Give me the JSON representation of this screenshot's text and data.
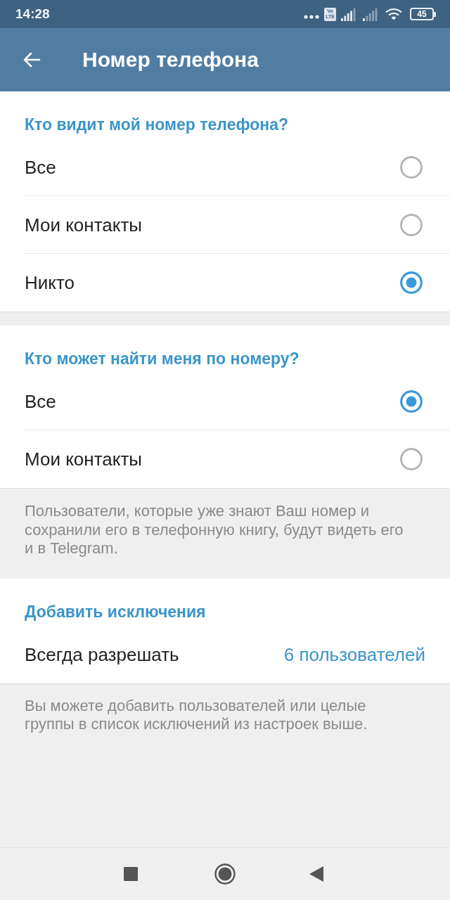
{
  "status_bar": {
    "time": "14:28",
    "network_badge": [
      "Vo",
      "LTE"
    ],
    "battery": "45"
  },
  "app_bar": {
    "title": "Номер телефона"
  },
  "sections": [
    {
      "header": "Кто видит мой номер телефона?",
      "items": [
        {
          "kind": "radio",
          "label": "Все",
          "selected": false
        },
        {
          "kind": "radio",
          "label": "Мои контакты",
          "selected": false
        },
        {
          "kind": "radio",
          "label": "Никто",
          "selected": true
        }
      ]
    },
    {
      "header": "Кто может найти меня по номеру?",
      "items": [
        {
          "kind": "radio",
          "label": "Все",
          "selected": true
        },
        {
          "kind": "radio",
          "label": "Мои контакты",
          "selected": false
        }
      ],
      "footnote": "Пользователи, которые уже знают Ваш номер и сохранили его в телефонную книгу, будут видеть его и в Telegram."
    },
    {
      "header": "Добавить исключения",
      "items": [
        {
          "kind": "value",
          "label": "Всегда разрешать",
          "value": "6 пользователей"
        }
      ],
      "footnote": "Вы можете добавить пользователей или целые группы в список исключений из настроек выше."
    }
  ]
}
